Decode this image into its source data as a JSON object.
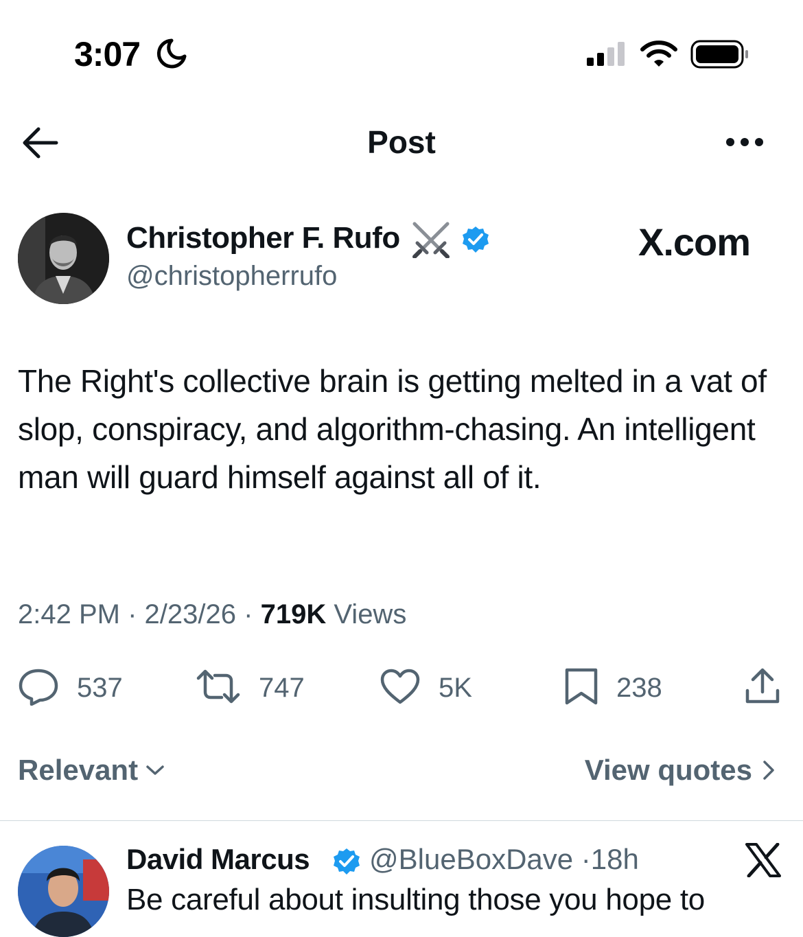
{
  "status_bar": {
    "time": "3:07"
  },
  "nav": {
    "title": "Post"
  },
  "post": {
    "author_name": "Christopher F. Rufo",
    "handle": "@christopherrufo",
    "watermark": "X.com",
    "text": "The Right's collective brain is getting melted in a vat of slop, conspiracy, and algorithm-chasing. An intelligent man will guard himself against all of it.",
    "time": "2:42 PM",
    "separator": "·",
    "date": "2/23/26",
    "views_count": "719K",
    "views_label": "Views",
    "replies": "537",
    "reposts": "747",
    "likes": "5K",
    "bookmarks": "238"
  },
  "sort": {
    "relevant_label": "Relevant",
    "view_quotes_label": "View quotes"
  },
  "reply": {
    "author_name": "David Marcus",
    "handle": "@BlueBoxDave",
    "separator": "·",
    "age": "18h",
    "text": "Be careful about insulting those you hope to"
  },
  "colors": {
    "verified": "#1d9bf0",
    "secondary_text": "#536471",
    "primary_text": "#0f1419"
  },
  "icons": [
    "moon-icon",
    "signal-icon",
    "wifi-icon",
    "battery-icon",
    "back-arrow-icon",
    "more-icon",
    "crossed-swords-icon",
    "verified-badge-icon",
    "reply-icon",
    "repost-icon",
    "like-icon",
    "bookmark-icon",
    "share-icon",
    "chevron-down-icon",
    "chevron-right-icon",
    "x-logo-icon"
  ]
}
